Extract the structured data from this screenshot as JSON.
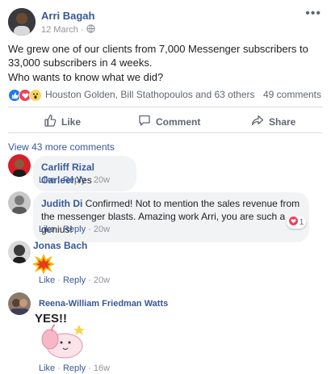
{
  "post": {
    "author": "Arri Bagah",
    "date": "12 March",
    "separator": "·",
    "more": "•••",
    "text_line1": "We grew one of our clients from 7,000 Messenger subscribers to 33,000 subscribers in 4 weeks.",
    "text_line2": "Who wants to know what we did?",
    "reactors": "Houston Golden, Bill Stathopoulos and 63 others",
    "comment_count": "49 comments"
  },
  "actions": {
    "like": "Like",
    "comment": "Comment",
    "share": "Share"
  },
  "view_more": "View 43 more comments",
  "comments": [
    {
      "name": "Carliff Rizal Carleel",
      "text": "Yes",
      "like": "Like",
      "reply": "Reply",
      "sep": "·",
      "time": "20w"
    },
    {
      "name": "Judith Di",
      "text": "Confirmed! Not to mention the sales revenue from the messenger blasts. Amazing work Arri, you are such a genius!",
      "like": "Like",
      "reply": "Reply",
      "sep": "·",
      "time": "20w",
      "reaction_count": "1"
    },
    {
      "name": "Jonas Bach",
      "like": "Like",
      "reply": "Reply",
      "sep": "·",
      "time": "20w"
    },
    {
      "name": "Reena-William Friedman Watts",
      "sticker_text": "YES!!",
      "like": "Like",
      "reply": "Reply",
      "sep": "·",
      "time": "16w"
    }
  ],
  "colors": {
    "link": "#385898",
    "like_blue": "#2078f4",
    "love_red": "#f33e58",
    "wow_yellow": "#fcd361"
  }
}
